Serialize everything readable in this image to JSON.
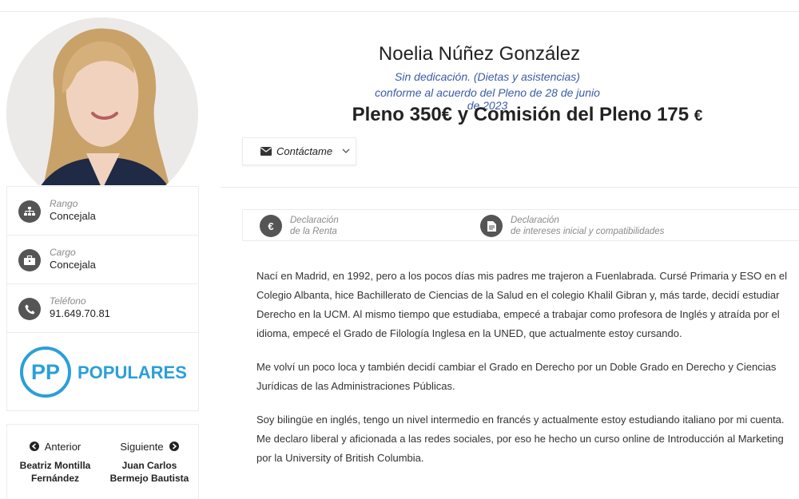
{
  "profile": {
    "name": "Noelia Núñez González",
    "dedication": "Sin dedicación. (Dietas y asistencias)",
    "agreement": "conforme al acuerdo del Pleno de 28 de junio de 2023",
    "salary": "Pleno 350€ y Comisión del Pleno 175",
    "salary_currency": "€"
  },
  "contact": {
    "label": "Contáctame",
    "icon": "envelope-icon"
  },
  "sidebar": {
    "rows": [
      {
        "label": "Rango",
        "value": "Concejala",
        "icon": "sitemap-icon"
      },
      {
        "label": "Cargo",
        "value": "Concejala",
        "icon": "briefcase-icon"
      },
      {
        "label": "Teléfono",
        "value": "91.649.70.81",
        "icon": "phone-icon"
      }
    ],
    "party": {
      "logo_letters": "PP",
      "logo_text": "POPULARES",
      "brand_color": "#2b9fd9"
    }
  },
  "navigation": {
    "prev": {
      "label": "Anterior",
      "name_line1": "Beatriz Montilla",
      "name_line2": "Fernández"
    },
    "next": {
      "label": "Siguiente",
      "name_line1": "Juan Carlos",
      "name_line2": "Bermejo Bautista"
    }
  },
  "declarations": [
    {
      "line1": "Declaración",
      "line2": "de la Renta",
      "icon": "euro-icon"
    },
    {
      "line1": "Declaración",
      "line2": "de intereses inicial y compatibilidades",
      "icon": "document-icon"
    }
  ],
  "bio": [
    "Nací en Madrid, en 1992, pero a los pocos días mis padres me trajeron a Fuenlabrada. Cursé Primaria y ESO en el Colegio Albanta, hice Bachillerato de Ciencias de la Salud en el colegio Khalil Gibran y, más tarde, decidí estudiar Derecho en la UCM. Al mismo tiempo que estudiaba, empecé a trabajar como profesora de Inglés y atraída por el idioma, empecé el Grado de Filología Inglesa en la UNED, que actualmente estoy cursando.",
    "Me volví un poco loca y también decidí cambiar el Grado en Derecho por un Doble Grado en Derecho y Ciencias Jurídicas de las Administraciones Públicas.",
    "Soy bilingüe en inglés, tengo un nivel intermedio en francés y actualmente estoy estudiando italiano por mi cuenta. Me declaro liberal y aficionada a las redes sociales, por eso he hecho un curso online de Introducción al Marketing por la University of British Columbia."
  ],
  "colors": {
    "accent_text": "#3a5ba6",
    "icon_bg": "#555555"
  }
}
